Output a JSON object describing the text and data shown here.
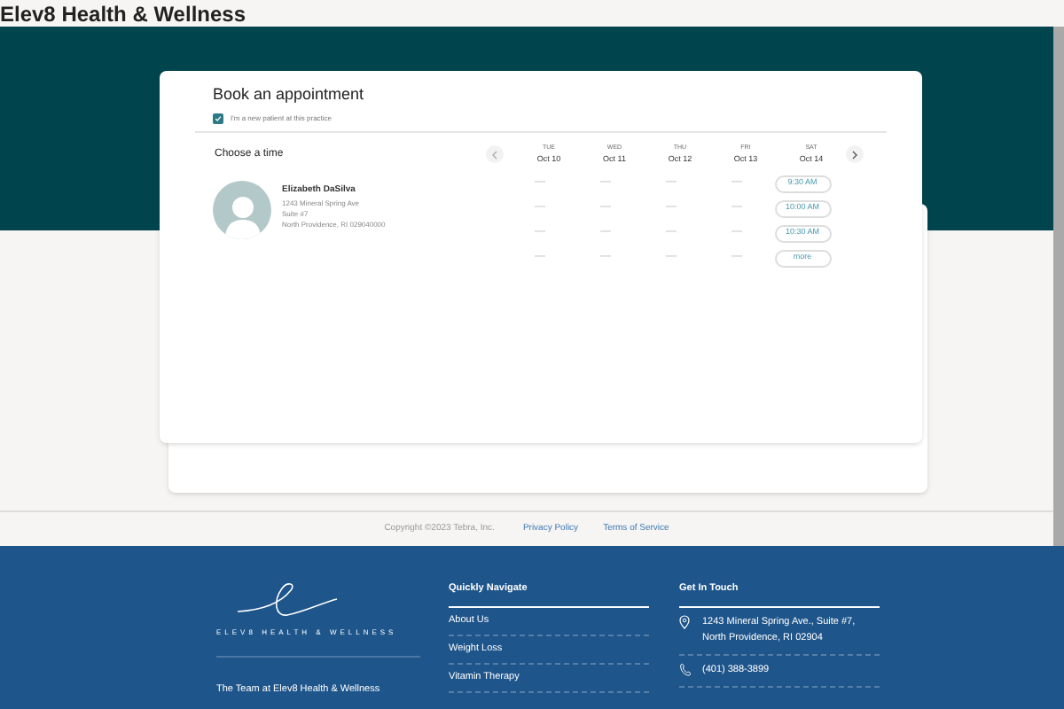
{
  "header": {
    "title": "Elev8 Health & Wellness"
  },
  "booking": {
    "title": "Book an appointment",
    "new_patient": {
      "label": "I'm a new patient at this practice",
      "checked": true
    },
    "choose_label": "Choose a time",
    "days": [
      {
        "weekday": "TUE",
        "date": "Oct 10",
        "slots": [
          "—",
          "—",
          "—",
          "—"
        ]
      },
      {
        "weekday": "WED",
        "date": "Oct 11",
        "slots": [
          "—",
          "—",
          "—",
          "—"
        ]
      },
      {
        "weekday": "THU",
        "date": "Oct 12",
        "slots": [
          "—",
          "—",
          "—",
          "—"
        ]
      },
      {
        "weekday": "FRI",
        "date": "Oct 13",
        "slots": [
          "—",
          "—",
          "—",
          "—"
        ]
      },
      {
        "weekday": "SAT",
        "date": "Oct 14",
        "slots": [
          "9:30 AM",
          "10:00 AM",
          "10:30 AM",
          "more"
        ]
      }
    ],
    "provider": {
      "name": "Elizabeth DaSilva",
      "address": [
        "1243 Mineral Spring Ave",
        "Suite #7",
        "North Providence, RI 029040000"
      ]
    }
  },
  "legal": {
    "copyright": "Copyright ©2023 Tebra, Inc.",
    "links": [
      "Privacy Policy",
      "Terms of Service"
    ]
  },
  "footer": {
    "logo_text": "ELEV8 HEALTH & WELLNESS",
    "about": "The Team at Elev8 Health & Wellness",
    "nav": {
      "title": "Quickly Navigate",
      "items": [
        "About Us",
        "Weight Loss",
        "Vitamin Therapy"
      ]
    },
    "contact": {
      "title": "Get In Touch",
      "items": [
        {
          "kind": "address",
          "text": "1243 Mineral Spring Ave., Suite #7, North Providence, RI 02904"
        },
        {
          "kind": "phone",
          "text": "(401) 388-3899"
        }
      ]
    }
  }
}
